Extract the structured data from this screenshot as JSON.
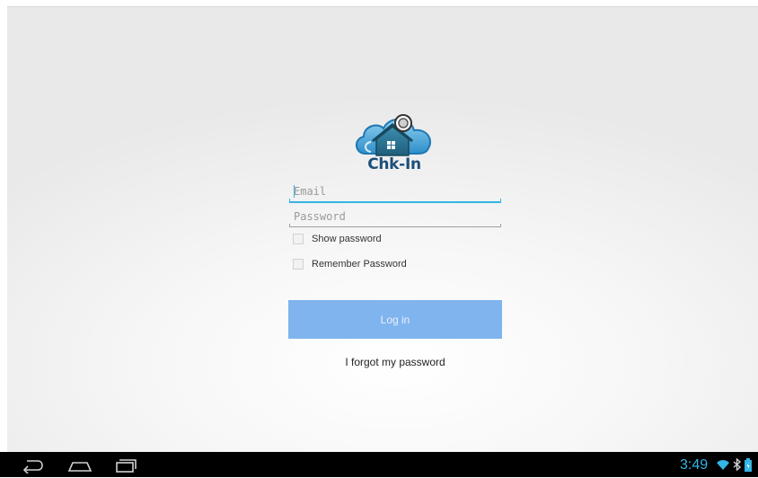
{
  "app": {
    "name": "Chk-In"
  },
  "login_form": {
    "email_placeholder": "Email",
    "password_placeholder": "Password",
    "show_password_label": "Show password",
    "show_password_checked": false,
    "remember_password_label": "Remember Password",
    "remember_password_checked": false,
    "login_button_label": "Log in",
    "forgot_password_label": "I forgot my password"
  },
  "status_bar": {
    "time": "3:49",
    "icons": [
      "wifi-icon",
      "bluetooth-icon",
      "battery-icon"
    ]
  },
  "navigation_bar": {
    "buttons": [
      "back-icon",
      "home-icon",
      "recent-apps-icon"
    ]
  },
  "colors": {
    "accent": "#33b5e5",
    "button": "#7fb4ee",
    "logo_blue": "#2f8fc9",
    "logo_house": "#2a6f8e"
  }
}
